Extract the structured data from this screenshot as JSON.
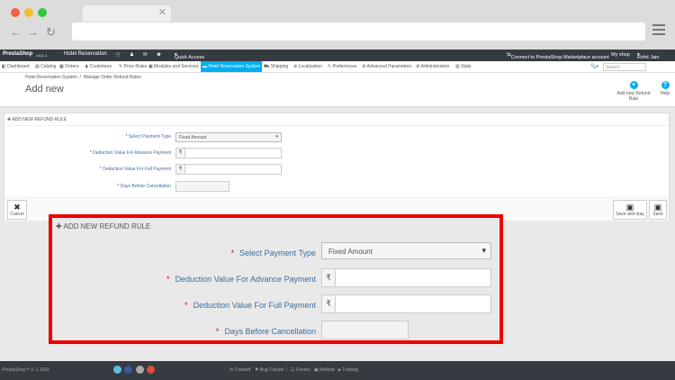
{
  "browser": {
    "address": ""
  },
  "topbar": {
    "logo": "PrestaShop",
    "version": "1.6.1.1",
    "shop_name": "Hotel Reservation",
    "quick_access": "Quick Access",
    "connect": "Connect to PrestaShop Marketplace account",
    "my_shop": "My shop",
    "user": "Rohit Jain"
  },
  "menu": {
    "items": [
      {
        "label": "Dashboard",
        "icon": "dashboard-icon"
      },
      {
        "label": "Catalog",
        "icon": "catalog-icon"
      },
      {
        "label": "Orders",
        "icon": "orders-icon"
      },
      {
        "label": "Customers",
        "icon": "customers-icon"
      },
      {
        "label": "Price Rules",
        "icon": "price-rules-icon"
      },
      {
        "label": "Modules and Services",
        "icon": "modules-icon"
      },
      {
        "label": "Hotel Reservation System",
        "icon": "hotel-icon"
      },
      {
        "label": "Shipping",
        "icon": "shipping-icon"
      },
      {
        "label": "Localization",
        "icon": "localization-icon"
      },
      {
        "label": "Preferences",
        "icon": "preferences-icon"
      },
      {
        "label": "Advanced Parameters",
        "icon": "advanced-parameters-icon"
      },
      {
        "label": "Administration",
        "icon": "administration-icon"
      },
      {
        "label": "Stats",
        "icon": "stats-icon"
      }
    ],
    "search_placeholder": "Search"
  },
  "header": {
    "breadcrumb_1": "Hotel Reservation System",
    "breadcrumb_sep": "/",
    "breadcrumb_2": "Manage Order Refund Rules",
    "title": "Add new",
    "add_button": "Add new Refund Rule",
    "help_button": "Help"
  },
  "form": {
    "heading": "ADD NEW REFUND RULE",
    "payment_type_label": "Select Payment Type",
    "payment_type_value": "Fixed Amount",
    "advance_label": "Deduction Value For Advance Payment",
    "full_label": "Deduction Value For Full Payment",
    "days_label": "Days Before Cancellation",
    "currency": "₹",
    "required_mark": "*",
    "cancel": "Cancel",
    "save_stay": "Save and stay",
    "save": "Save"
  },
  "footer": {
    "brand": "PrestaShop™",
    "time": "1.160s",
    "links": [
      "Contact",
      "Bug Tracker",
      "Forum",
      "Addons",
      "Training"
    ],
    "separator": "/"
  },
  "colors": {
    "accent": "#00aff0",
    "highlight": "#e00000",
    "dark_bar": "#363a41"
  }
}
